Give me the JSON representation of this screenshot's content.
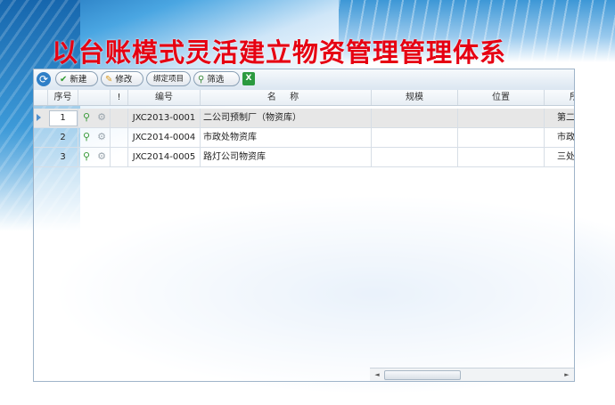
{
  "headline": "以台账模式灵活建立物资管理管理体系",
  "toolbar": {
    "refresh_icon": "refresh-icon",
    "new_label": "新建",
    "edit_label": "修改",
    "bind_label": "绑定项目",
    "filter_label": "筛选",
    "excel_icon": "excel-export-icon"
  },
  "grid": {
    "headers": {
      "seq": "序号",
      "flag": "!",
      "code": "编号",
      "name": "名 称",
      "scale": "规模",
      "location": "位置",
      "owner": "所"
    },
    "rows": [
      {
        "seq": "1",
        "code": "JXC2013-0001",
        "name": "二公司预制厂（物资库）",
        "owner": "第二",
        "selected": true
      },
      {
        "seq": "2",
        "code": "JXC2014-0004",
        "name": "市政处物资库",
        "owner": "市政设"
      },
      {
        "seq": "3",
        "code": "JXC2014-0005",
        "name": "路灯公司物资库",
        "owner": "三处"
      }
    ]
  },
  "scrollbar": {
    "left_arrow": "◄",
    "right_arrow": "►"
  }
}
